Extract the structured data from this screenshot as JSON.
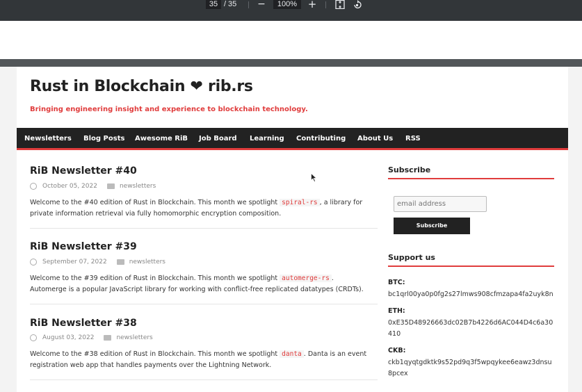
{
  "viewer": {
    "current_page": "35",
    "separator": "/",
    "total_pages": "35",
    "zoom_out": "−",
    "zoom_level": "100%",
    "zoom_in": "+"
  },
  "site": {
    "title": "Rust in Blockchain ❤ rib.rs",
    "tagline": "Bringing engineering insight and experience to blockchain technology."
  },
  "nav": [
    "Newsletters",
    "Blog Posts",
    "Awesome RiB",
    "Job Board",
    "Learning",
    "Contributing",
    "About Us",
    "RSS"
  ],
  "posts": [
    {
      "title": "RiB Newsletter #40",
      "date": "October 05, 2022",
      "category": "newsletters",
      "excerpt_before": "Welcome to the #40 edition of Rust in Blockchain. This month we spotlight ",
      "code": "spiral-rs",
      "excerpt_after": ", a library for private information retrieval via fully homomorphic encryption composition."
    },
    {
      "title": "RiB Newsletter #39",
      "date": "September 07, 2022",
      "category": "newsletters",
      "excerpt_before": "Welcome to the #39 edition of Rust in Blockchain. This month we spotlight ",
      "code": "automerge-rs",
      "excerpt_after": ". Automerge is a popular JavaScript library for working with conflict-free replicated datatypes (CRDTs)."
    },
    {
      "title": "RiB Newsletter #38",
      "date": "August 03, 2022",
      "category": "newsletters",
      "excerpt_before": "Welcome to the #38 edition of Rust in Blockchain. This month we spotlight ",
      "code": "danta",
      "excerpt_after": ". Danta is an event registration web app that handles payments over the Lightning Network."
    }
  ],
  "sidebar": {
    "subscribe_title": "Subscribe",
    "email_placeholder": "email address",
    "subscribe_button": "Subscribe",
    "support_title": "Support us",
    "btc_label": "BTC:",
    "btc_address": "bc1qrl00ya0p0fg2s27lmws908cfmzapa4fa2uyk8n",
    "eth_label": "ETH:",
    "eth_address": "0xE35D48926663dc02B7b4226d6AC044D4c6a30410",
    "ckb_label": "CKB:",
    "ckb_address": "ckb1qyqtgdktk9s52pd9q3f5wpqykee6eawz3dnsu8pcex"
  },
  "colors": {
    "accent": "#e03c3c",
    "navbar": "#222222",
    "viewer_toolbar": "#323639"
  }
}
